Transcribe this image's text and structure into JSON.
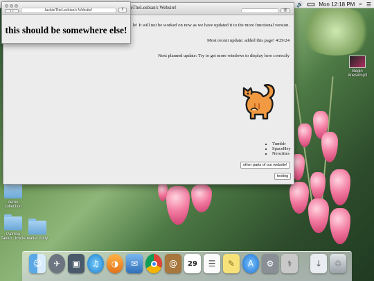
{
  "menubar": {
    "datetime": "Mon 12:18 PM",
    "wifi_icon": "wifi-icon",
    "search_icon": "spotlight-icon",
    "menu_icon": "list-icon"
  },
  "main_window": {
    "title": "JackieTheLesbian's Website!",
    "lines": [
      "le! It will not be worked on now as we have updated it to the more functional version.",
      "Most recent update: added this page! 4/29/24",
      "Next planned update: Try to get more windows to display here correctly"
    ],
    "links": [
      "Tumblr",
      "SpaceHey",
      "Neocities"
    ],
    "button_other": "other parts of our website!",
    "button_testing": "testing",
    "cat_icon": "cat-icon"
  },
  "popup_window": {
    "url": "JackieTheLesbian's Website!",
    "heading": "this should be somewhere else!"
  },
  "desktop": {
    "icons": [
      {
        "label": "Begin\nAnesvmp3"
      },
      {
        "label": "demo\ncollection"
      },
      {
        "label": "Patricia\nTakko...icycle"
      },
      {
        "label": "walter mitty"
      }
    ]
  },
  "dock": [
    "finder-icon",
    "launchpad-icon",
    "photo-icon",
    "itunes-icon",
    "mail-icon",
    "preview-icon",
    "chrome-icon",
    "addressbook-icon",
    "calendar-icon",
    "reminders-icon",
    "notes-icon",
    "appstore-icon",
    "preferences-icon",
    "utility-icon",
    "downloads-icon",
    "trash-icon"
  ],
  "calendar_day": "29"
}
